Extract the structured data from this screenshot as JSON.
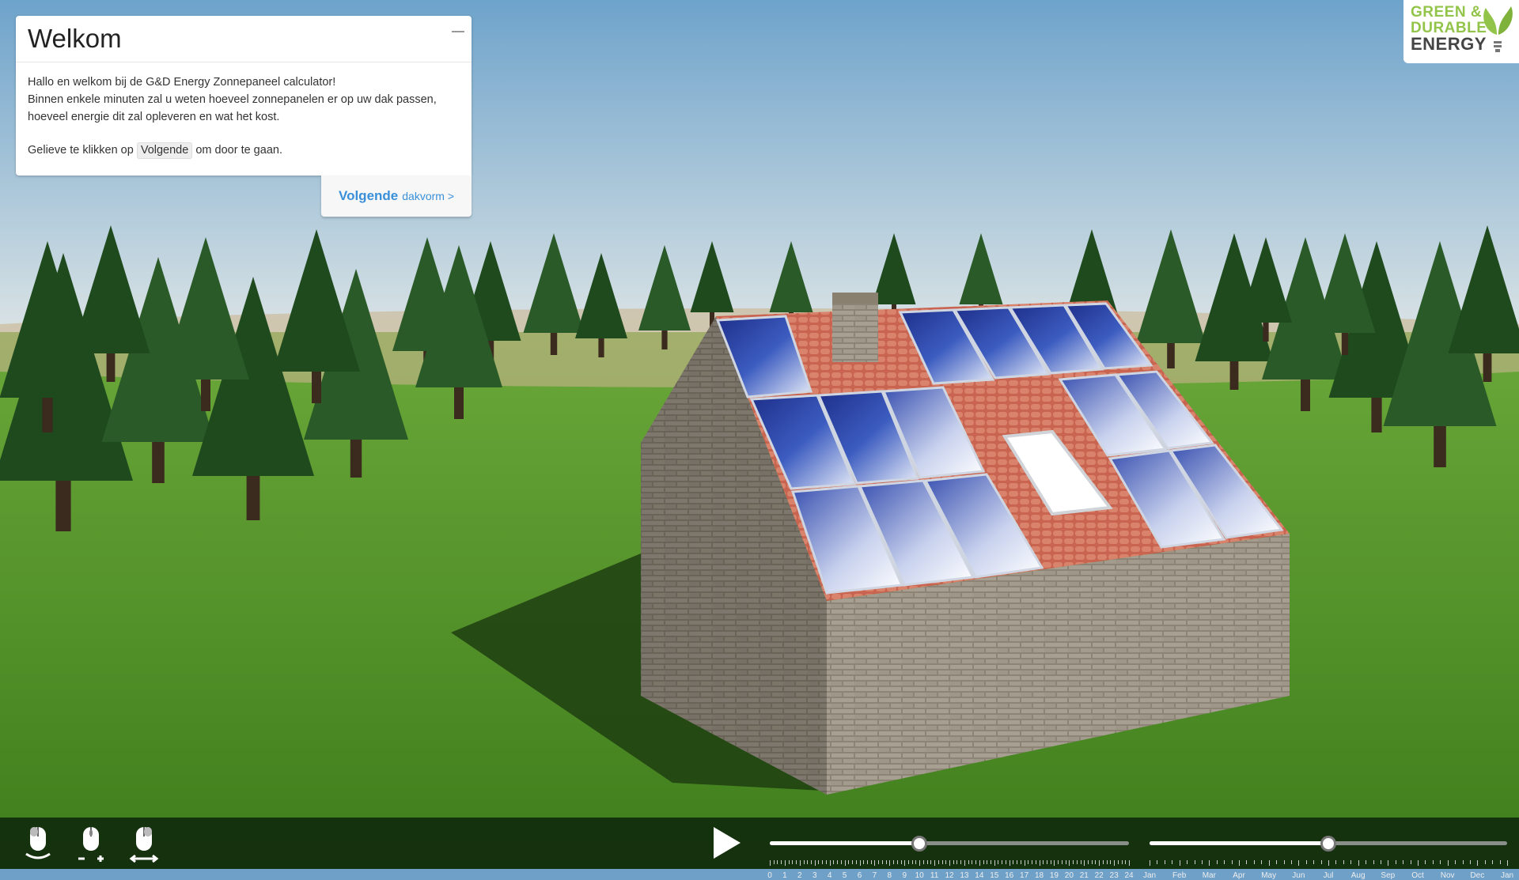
{
  "panel": {
    "title": "Welkom",
    "line1": "Hallo en welkom bij de G&D Energy Zonnepaneel calculator!",
    "line2": "Binnen enkele minuten zal u weten hoeveel zonnepanelen er op uw dak passen,",
    "line3": "hoeveel energie dit zal opleveren en wat het kost.",
    "instr_before": "Gelieve te klikken op",
    "instr_key": "Volgende",
    "instr_after": "om door te gaan."
  },
  "next_button": {
    "label": "Volgende",
    "sub": "dakvorm >"
  },
  "logo": {
    "line1": "GREEN &",
    "line2": "DURABLE",
    "line3": "ENERGY"
  },
  "toolbar": {
    "icons": [
      "mouse-rotate-icon",
      "mouse-zoom-icon",
      "mouse-pan-icon"
    ],
    "hour_slider": {
      "labels": [
        "0",
        "1",
        "2",
        "3",
        "4",
        "5",
        "6",
        "7",
        "8",
        "9",
        "10",
        "11",
        "12",
        "13",
        "14",
        "15",
        "16",
        "17",
        "18",
        "19",
        "20",
        "21",
        "22",
        "23",
        "24"
      ],
      "value": 10
    },
    "month_slider": {
      "labels": [
        "Jan",
        "Feb",
        "Mar",
        "Apr",
        "May",
        "Jun",
        "Jul",
        "Aug",
        "Sep",
        "Oct",
        "Nov",
        "Dec",
        "Jan"
      ],
      "value": 6
    }
  },
  "colors": {
    "accent": "#3a8fd9",
    "grass": "#5a9a2c",
    "brand_green": "#93c44a"
  }
}
